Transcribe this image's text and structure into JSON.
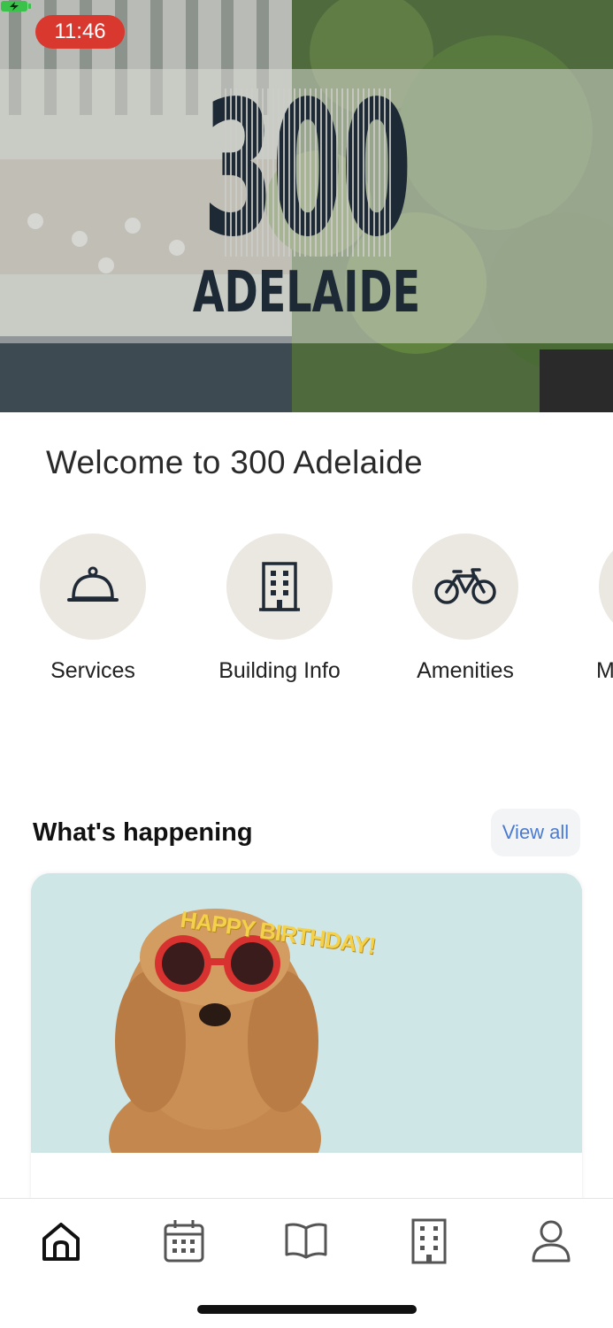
{
  "status_bar": {
    "time": "11:46"
  },
  "hero": {
    "logo_number": "300",
    "logo_word": "ADELAIDE"
  },
  "welcome": {
    "title": "Welcome to 300 Adelaide"
  },
  "quick_links": [
    {
      "label": "Services",
      "icon": "service-bell-icon"
    },
    {
      "label": "Building Info",
      "icon": "building-icon"
    },
    {
      "label": "Amenities",
      "icon": "bicycle-icon"
    },
    {
      "label": "M",
      "icon": "partial-item-icon"
    }
  ],
  "happening": {
    "title": "What's happening",
    "view_all": "View all",
    "card": {
      "image_caption": "HAPPY BIRTHDAY!"
    }
  },
  "tabbar": {
    "items": [
      {
        "icon": "home-icon",
        "active": true
      },
      {
        "icon": "calendar-icon",
        "active": false
      },
      {
        "icon": "book-icon",
        "active": false
      },
      {
        "icon": "building-icon",
        "active": false
      },
      {
        "icon": "profile-icon",
        "active": false
      }
    ]
  },
  "colors": {
    "status_pill": "#d9382f",
    "logo": "#1d2a36",
    "quick_circle": "#ebe7e1",
    "link": "#4a7bd0",
    "card_bg": "#cfe6e6"
  }
}
